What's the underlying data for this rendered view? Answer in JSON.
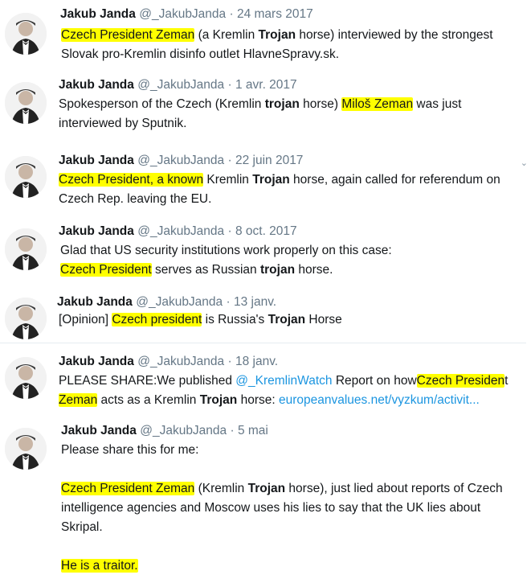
{
  "author": {
    "name": "Jakub Janda",
    "handle": "@_JakubJanda",
    "sep": "·"
  },
  "tweets": [
    {
      "date": "24 mars 2017",
      "line1": [
        "Czech President Zeman",
        " (a Kremlin ",
        "Trojan",
        " horse) interviewed by the strongest"
      ],
      "line2": "Slovak pro-Kremlin disinfo outlet HlavneSpravy.sk."
    },
    {
      "date": "1 avr. 2017",
      "line1": [
        "Spokesperson of the Czech (Kremlin ",
        "trojan",
        " horse) ",
        "Miloš Zeman",
        " was just"
      ],
      "line2": "interviewed by Sputnik."
    },
    {
      "date": "22 juin 2017",
      "line1": [
        "Czech President, a known",
        " Kremlin ",
        "Trojan",
        " horse, again called for referendum on"
      ],
      "line2": "Czech Rep. leaving the EU."
    },
    {
      "date": "8 oct. 2017",
      "line1": "Glad that US security institutions work properly on this case:",
      "line2": [
        "Czech President",
        " serves as Russian ",
        "trojan",
        " horse."
      ]
    },
    {
      "date": "13 janv.",
      "line1": [
        "[Opinion] ",
        "Czech president",
        " is Russia's ",
        "Trojan",
        " Horse"
      ]
    },
    {
      "date": "18 janv.",
      "line1": [
        "PLEASE SHARE:We published ",
        "@_KremlinWatch",
        " Report on how",
        "Czech Presiden",
        "t"
      ],
      "line2": [
        "Zeman",
        " acts as a Kremlin ",
        "Trojan",
        " horse: ",
        "europeanvalues.net/vyzkum/activit..."
      ]
    },
    {
      "date": "5 mai",
      "line1": "Please share this for me:",
      "line2": [
        "Czech President Zeman",
        " (Kremlin ",
        "Trojan",
        " horse), just lied about reports of Czech"
      ],
      "line3": "intelligence agencies and Moscow uses his lies to say that the UK lies about",
      "line4": "Skripal.",
      "line5": "He is a traitor."
    }
  ],
  "icons": {
    "chevron": "chevron-down-icon",
    "avatar": "avatar"
  },
  "colors": {
    "highlight": "#ffff00",
    "link": "#1b95e0",
    "meta": "#657786"
  }
}
